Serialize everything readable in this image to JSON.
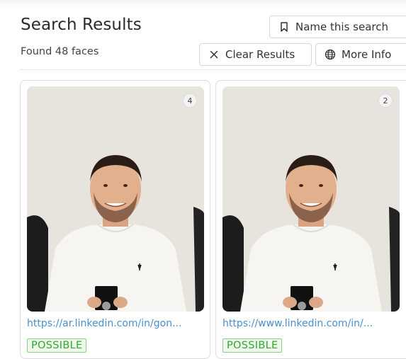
{
  "header": {
    "title": "Search Results",
    "subtitle": "Found 48 faces"
  },
  "toolbar": {
    "name_search_label": "Name this search",
    "name_search_icon": "bookmark-icon",
    "clear_label": "Clear Results",
    "clear_icon": "x-icon",
    "more_info_label": "More Info",
    "more_info_icon": "globe-icon"
  },
  "results": [
    {
      "badge": "4",
      "url": "https://ar.linkedin.com/in/gon...",
      "status": "POSSIBLE"
    },
    {
      "badge": "2",
      "url": "https://www.linkedin.com/in/...",
      "status": "POSSIBLE"
    }
  ],
  "colors": {
    "link": "#4a8fd0",
    "status_text": "#2ea82e",
    "status_bg": "#eef9ec",
    "status_border": "#86d18a"
  }
}
